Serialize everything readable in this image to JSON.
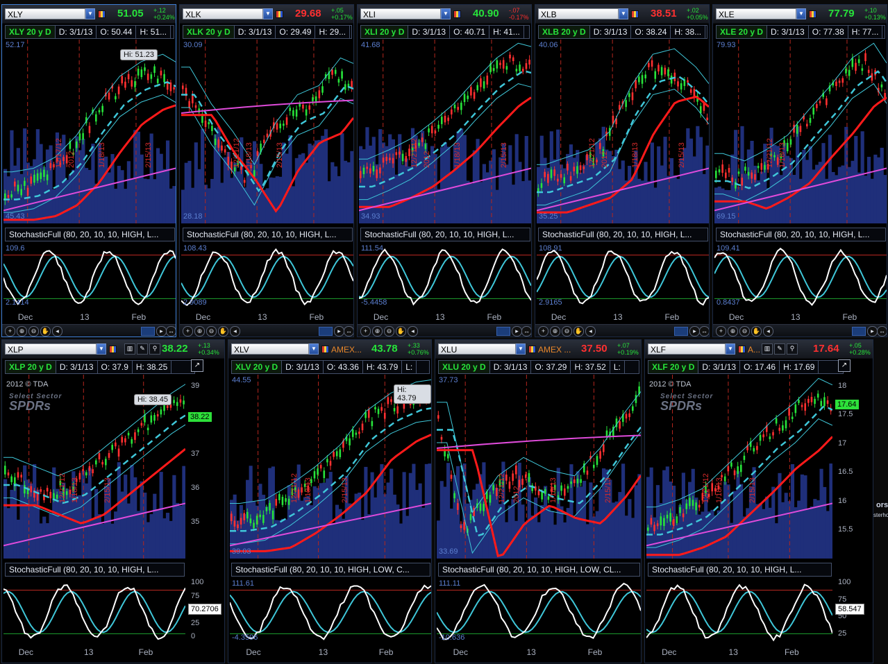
{
  "panels": [
    {
      "key": "xly",
      "symbol": "XLY",
      "exchange": "",
      "last": "51.05",
      "change": "+.12",
      "change_pct": "+0.24%",
      "dir": "up",
      "info": {
        "period": "XLY 20 y D",
        "date": "D: 3/1/13",
        "open": "O: 50.44",
        "high": "H: 51..."
      },
      "price_top": "52.17",
      "price_bot": "45.43",
      "hi_tag": "Hi: 51.23",
      "stoch_title": "StochasticFull (80, 20, 10, 10, HIGH, L...",
      "stoch_top": "109.6",
      "stoch_bot": "2.1414",
      "dates": [
        "Dec",
        "13",
        "Feb"
      ],
      "vdates": [
        "12/17/12",
        "2012",
        "1/18/13",
        "2/15/13"
      ],
      "active": true
    },
    {
      "key": "xlk",
      "symbol": "XLK",
      "exchange": "",
      "last": "29.68",
      "change": "+.05",
      "change_pct": "+0.17%",
      "dir": "dn",
      "info": {
        "period": "XLK 20 y D",
        "date": "D: 3/1/13",
        "open": "O: 29.49",
        "high": "H: 29..."
      },
      "price_top": "30.09",
      "price_bot": "28.18",
      "stoch_title": "StochasticFull (80, 20, 10, 10, HIGH, L...",
      "stoch_top": "108.43",
      "stoch_bot": "2.9089",
      "dates": [
        "Dec",
        "13",
        "Feb"
      ],
      "vdates": [
        "12/21/12",
        "1/18/13",
        "2/15/13"
      ]
    },
    {
      "key": "xli",
      "symbol": "XLI",
      "exchange": "",
      "last": "40.90",
      "change": "-.07",
      "change_pct": "-0.17%",
      "dir": "up",
      "info": {
        "period": "XLI 20 y D",
        "date": "D: 3/1/13",
        "open": "O: 40.71",
        "high": "H: 41..."
      },
      "price_top": "41.68",
      "price_bot": "34.93",
      "stoch_title": "StochasticFull (80, 20, 10, 10, HIGH, L...",
      "stoch_top": "111.54",
      "stoch_bot": "-5.4458",
      "dates": [
        "Dec",
        "13",
        "Feb"
      ],
      "vdates": [
        "12/21/12",
        "2012",
        "1/18/13",
        "2/15/13"
      ]
    },
    {
      "key": "xlb",
      "symbol": "XLB",
      "exchange": "",
      "last": "38.51",
      "change": "+.02",
      "change_pct": "+0.05%",
      "dir": "dn",
      "info": {
        "period": "XLB 20 y D",
        "date": "D: 3/1/13",
        "open": "O: 38.24",
        "high": "H: 38..."
      },
      "price_top": "40.06",
      "price_bot": "35.25",
      "stoch_title": "StochasticFull (80, 20, 10, 10, HIGH, L...",
      "stoch_top": "108.91",
      "stoch_bot": "2.9165",
      "dates": [
        "Dec",
        "13",
        "Feb"
      ],
      "vdates": [
        "12/21/12",
        "2012",
        "1/18/13",
        "2/15/13"
      ]
    },
    {
      "key": "xle",
      "symbol": "XLE",
      "exchange": "",
      "last": "77.79",
      "change": "+.10",
      "change_pct": "+0.13%",
      "dir": "up",
      "info": {
        "period": "XLE 20 y D",
        "date": "D: 3/1/13",
        "open": "O: 77.38",
        "high": "H: 77..."
      },
      "price_top": "79.93",
      "price_bot": "69.15",
      "stoch_title": "StochasticFull (80, 20, 10, 10, HIGH, L...",
      "stoch_top": "109.41",
      "stoch_bot": "0.8437",
      "dates": [
        "Dec",
        "13",
        "Feb"
      ],
      "vdates": [
        "12/21/12",
        "1/18/13"
      ]
    },
    {
      "key": "xlp",
      "symbol": "XLP",
      "exchange": "",
      "last": "38.22",
      "change": "+.13",
      "change_pct": "+0.34%",
      "dir": "up",
      "info": {
        "period": "XLP 20 y D",
        "date": "D: 3/1/13",
        "open": "O: 37.9",
        "high": "H: 38.25"
      },
      "copyright": "2012 © TDA",
      "brand1": "Select Sector",
      "brand2": "SPDRs",
      "hi_tag": "Hi: 38.45",
      "price_tag": "38.22",
      "axis": [
        "39",
        "38",
        "37",
        "36",
        "35"
      ],
      "stoch_title": "StochasticFull (80, 20, 10, 10, HIGH, L...",
      "stoch_axis": [
        "100",
        "75",
        "50",
        "25",
        "0"
      ],
      "stoch_tag": "70.2706",
      "dates": [
        "Dec",
        "13",
        "Feb"
      ],
      "vdates": [
        "12/21/12",
        "1/18/13",
        "2/15/13"
      ]
    },
    {
      "key": "xlv",
      "symbol": "XLV",
      "exchange": "AMEX...",
      "last": "43.78",
      "change": "+.33",
      "change_pct": "+0.76%",
      "dir": "up",
      "info": {
        "period": "XLV 20 y D",
        "date": "D: 3/1/13",
        "open": "O: 43.36",
        "high": "H: 43.79",
        "extra": "L:"
      },
      "price_top": "44.55",
      "price_bot": "39.03",
      "hi_tag": "Hi: 43.79",
      "stoch_title": "StochasticFull (80, 20, 10, 10, HIGH, LOW, C...",
      "stoch_top": "111.61",
      "stoch_bot": "-4.3596",
      "dates": [
        "Dec",
        "13",
        "Feb"
      ],
      "vdates": [
        "12/21/12",
        "1/18/13",
        "2/15/13"
      ]
    },
    {
      "key": "xlu",
      "symbol": "XLU",
      "exchange": "AMEX ...",
      "last": "37.50",
      "change": "+.07",
      "change_pct": "+0.19%",
      "dir": "dn",
      "info": {
        "period": "XLU 20 y D",
        "date": "D: 3/1/13",
        "open": "O: 37.29",
        "high": "H: 37.52",
        "extra": "L:"
      },
      "price_top": "37.73",
      "price_bot": "33.69",
      "stoch_title": "StochasticFull (80, 20, 10, 10, HIGH, LOW, CL...",
      "stoch_top": "111.11",
      "stoch_bot": "-10.636",
      "dates": [
        "Dec",
        "13",
        "Feb"
      ],
      "vdates": [
        "12/21/12",
        "2012",
        "1/18/13",
        "2/15/13"
      ]
    },
    {
      "key": "xlf",
      "symbol": "XLF",
      "exchange": "A...",
      "last": "17.64",
      "change": "+.05",
      "change_pct": "+0.28%",
      "dir": "dn",
      "info": {
        "period": "XLF 20 y D",
        "date": "D: 3/1/13",
        "open": "O: 17.46",
        "high": "H: 17.69"
      },
      "copyright": "2012 © TDA",
      "brand1": "Select Sector",
      "brand2": "SPDRs",
      "price_tag": "17.64",
      "axis": [
        "18",
        "17.5",
        "17",
        "16.5",
        "16",
        "15.5"
      ],
      "stoch_title": "StochasticFull (80, 20, 10, 10, HIGH, L...",
      "stoch_axis": [
        "100",
        "75",
        "50",
        "25"
      ],
      "stoch_tag": "58.547",
      "dates": [
        "Dec",
        "13",
        "Feb"
      ],
      "vdates": [
        "12/21/12",
        "1/18/13",
        "2/15/13"
      ]
    }
  ],
  "edge_text": {
    "line1": "ors",
    "line2": "sterho"
  },
  "icons": {
    "dropdown": "chevron-down-icon",
    "flag": "link-color-icon",
    "zoom_in": "zoom-in-icon",
    "zoom_out": "zoom-out-icon",
    "pan": "hand-pan-icon",
    "crosshair": "crosshair-icon"
  },
  "colors": {
    "up": "#27e33a",
    "down": "#ff3030",
    "bollinger": "#3fc7d9",
    "sma_red": "#ff1a1a",
    "sma_magenta": "#e04bdb",
    "volume": "#1f2f7a",
    "stoch_k": "#ffffff",
    "stoch_d": "#3fc7d9"
  }
}
